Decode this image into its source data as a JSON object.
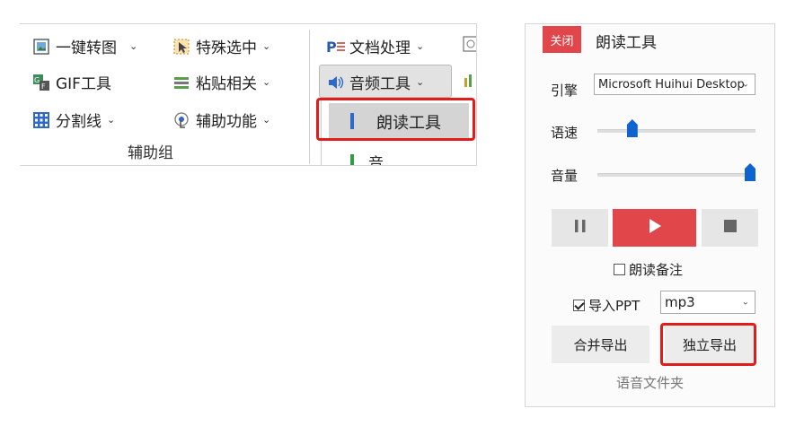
{
  "ribbon": {
    "items": [
      {
        "label": "一键转图",
        "icon": "image-convert-icon"
      },
      {
        "label": "特殊选中",
        "icon": "cursor-select-icon"
      },
      {
        "label": "文档处理",
        "icon": "document-process-icon"
      },
      {
        "label": "GIF工具",
        "icon": "gif-icon"
      },
      {
        "label": "粘贴相关",
        "icon": "paste-icon"
      },
      {
        "label": "音频工具",
        "icon": "speaker-icon"
      },
      {
        "label": "分割线",
        "icon": "grid-icon"
      },
      {
        "label": "辅助功能",
        "icon": "touch-icon"
      }
    ],
    "group_label": "辅助组",
    "dropdown": {
      "items": [
        "朗读工具",
        "音频拆合"
      ]
    }
  },
  "panel": {
    "close_label": "关闭",
    "title": "朗读工具",
    "engine_label": "引擎",
    "engine_value": "Microsoft Huihui Desktop",
    "speed_label": "语速",
    "speed_value": 0.2,
    "volume_label": "音量",
    "volume_value": 1.0,
    "read_notes_label": "朗读备注",
    "read_notes_checked": false,
    "import_ppt_label": "导入PPT",
    "import_ppt_checked": true,
    "format_value": "mp3",
    "merge_export_label": "合并导出",
    "separate_export_label": "独立导出",
    "footer_label": "语音文件夹"
  },
  "colors": {
    "accent_red": "#e0464a",
    "highlight_red": "#e21b1b",
    "slider_blue": "#0e63d0"
  }
}
